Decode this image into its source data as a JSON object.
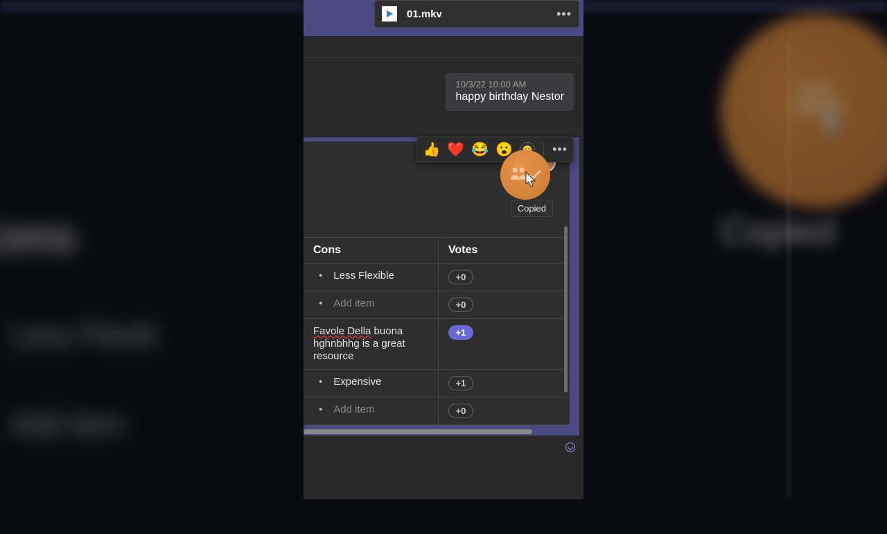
{
  "attachment": {
    "filename": "01.mkv"
  },
  "message": {
    "timestamp": "10/3/22 10:00 AM",
    "text": "happy birthday Nestor"
  },
  "reactions": {
    "like": "👍",
    "heart": "❤️",
    "laugh": "😂",
    "surprised": "😮"
  },
  "copied_tooltip": "Copied",
  "table": {
    "headers": {
      "cons": "Cons",
      "votes": "Votes"
    },
    "rows": [
      {
        "text": "Less Flexible",
        "vote": "+0",
        "is_add": false,
        "bullet": true,
        "active": false
      },
      {
        "text": "Add item",
        "vote": "+0",
        "is_add": true,
        "bullet": true,
        "active": false
      },
      {
        "text_a": "Favole Della",
        "text_b": " buona hghnbhhg is a great resource",
        "vote": "+1",
        "is_add": false,
        "bullet": false,
        "active": true
      },
      {
        "text": "Expensive",
        "vote": "+1",
        "is_add": false,
        "bullet": true,
        "active": false
      },
      {
        "text": "Add item",
        "vote": "+0",
        "is_add": true,
        "bullet": true,
        "active": false
      }
    ]
  },
  "bg": {
    "cons": "Cons",
    "votes_partial": "es",
    "row1": "Less Flexib",
    "row2": "Add item",
    "copied": "Copied"
  }
}
